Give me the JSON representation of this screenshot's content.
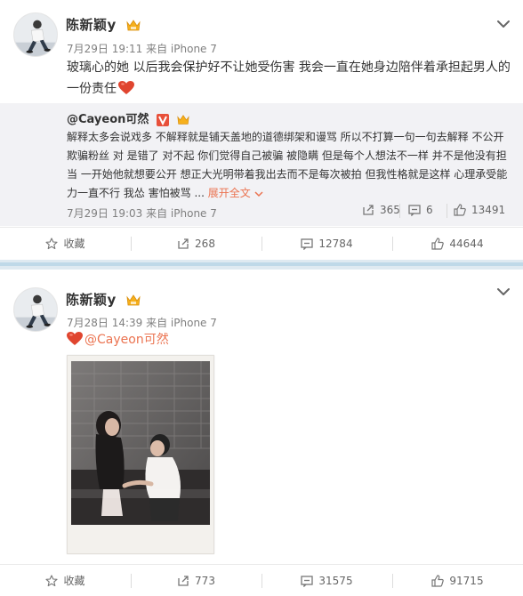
{
  "posts": [
    {
      "username": "陈新颖y",
      "meta": "7月29日 19:11 来自 iPhone 7",
      "text": "玻璃心的她 以后我会保护好不让她受伤害 我会一直在她身边陪伴着承担起男人的一份责任",
      "repost": {
        "username": "@Cayeon可然",
        "text": "解释太多会说戏多 不解释就是铺天盖地的道德绑架和谩骂 所以不打算一句一句去解释 不公开 欺骗粉丝 对 是错了 对不起 你们觉得自己被骗 被隐瞒 但是每个人想法不一样 并不是他没有担当 一开始他就想要公开 想正大光明带着我出去而不是每次被拍 但我性格就是这样 心理承受能力一直不行 我怂 害怕被骂 ...",
        "expand_label": "展开全文",
        "meta": "7月29日 19:03 来自 iPhone 7",
        "reposts": "365",
        "comments": "6",
        "likes": "13491"
      },
      "actions": {
        "favorite": "收藏",
        "reposts": "268",
        "comments": "12784",
        "likes": "44644"
      }
    },
    {
      "username": "陈新颖y",
      "meta": "7月28日 14:39 来自 iPhone 7",
      "mention": "@Cayeon可然",
      "actions": {
        "favorite": "收藏",
        "reposts": "773",
        "comments": "31575",
        "likes": "91715"
      }
    }
  ],
  "colors": {
    "accent": "#eb7350",
    "heart": "#e0452f",
    "badge": "#f6b01c",
    "separator": "#bfd9e8",
    "repost_bg": "#f2f2f5"
  },
  "icons": [
    "avatar-photo",
    "verified-badge-icon",
    "chevron-down-icon",
    "heart-emoji-icon",
    "star-icon",
    "repost-icon",
    "comment-icon",
    "like-icon"
  ]
}
